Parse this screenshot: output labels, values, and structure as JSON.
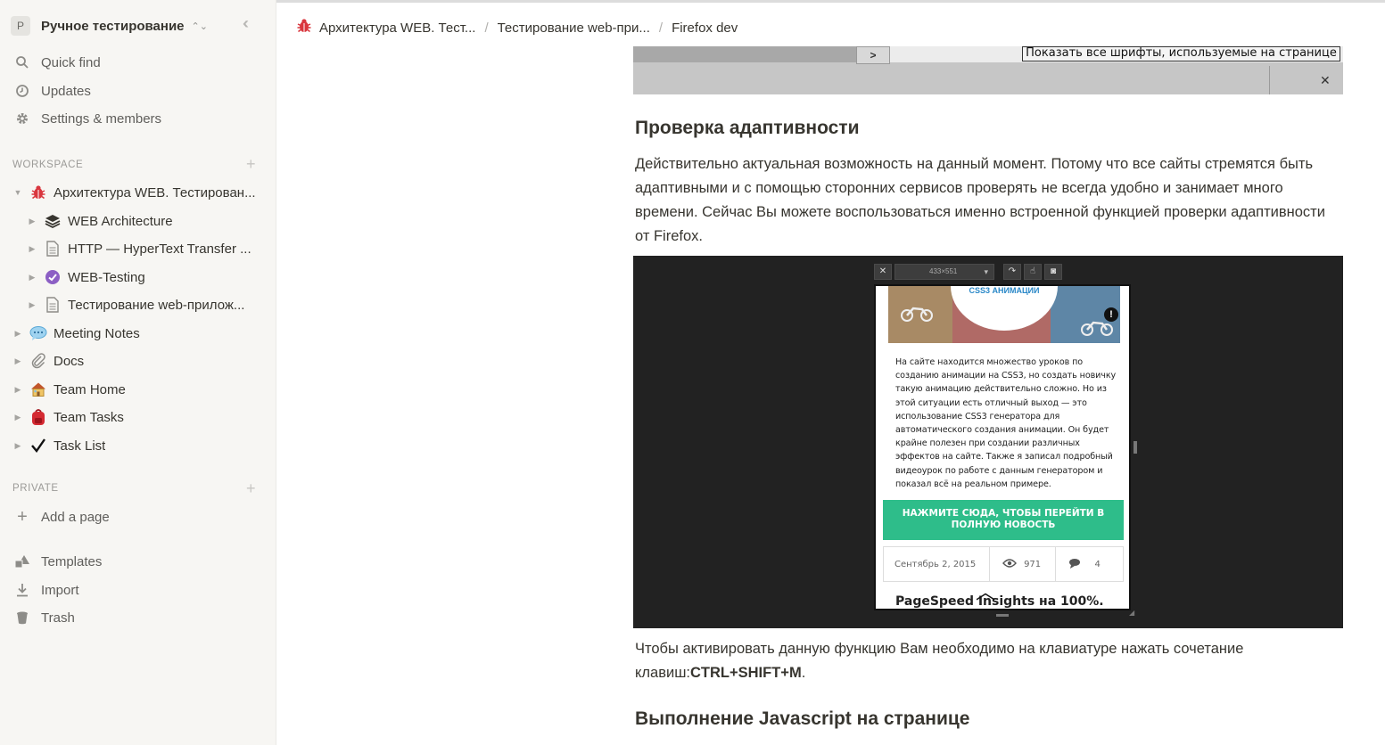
{
  "workspace": {
    "initial": "P",
    "name": "Ручное тестирование"
  },
  "sidebar": {
    "nav": [
      {
        "label": "Quick find",
        "icon": "search-icon"
      },
      {
        "label": "Updates",
        "icon": "clock-icon"
      },
      {
        "label": "Settings & members",
        "icon": "gear-icon"
      }
    ],
    "workspace_label": "WORKSPACE",
    "workspace_root": {
      "label": "Архитектура WEB. Тестирован...",
      "icon": "bug-icon"
    },
    "workspace_children": [
      {
        "label": "WEB Architecture",
        "icon": "layers-icon"
      },
      {
        "label": "HTTP — HyperText Transfer ...",
        "icon": "page-icon"
      },
      {
        "label": "WEB-Testing",
        "icon": "check-circle-icon"
      },
      {
        "label": "Тестирование web-прилож...",
        "icon": "page-icon"
      }
    ],
    "workspace_items": [
      {
        "label": "Meeting Notes",
        "icon": "speech-bubble-icon"
      },
      {
        "label": "Docs",
        "icon": "paperclip-icon"
      },
      {
        "label": "Team Home",
        "icon": "house-icon"
      },
      {
        "label": "Team Tasks",
        "icon": "backpack-icon"
      },
      {
        "label": "Task List",
        "icon": "checkmark-icon"
      }
    ],
    "private_label": "PRIVATE",
    "add_page": "Add a page",
    "footer": [
      {
        "label": "Templates",
        "icon": "shapes-icon"
      },
      {
        "label": "Import",
        "icon": "download-icon"
      },
      {
        "label": "Trash",
        "icon": "trash-icon"
      }
    ]
  },
  "breadcrumb": [
    "Архитектура WEB. Тест...",
    "Тестирование web-при...",
    "Firefox dev"
  ],
  "content": {
    "fonts_button": "Показать все шрифты, используемые на странице",
    "heading_adaptive": "Проверка адаптивности",
    "para_adaptive": "Действительно актуальная возможность на данный момент. Потому что все сайты стремятся быть адаптивными и с помощью сторонних сервисов проверять не всегда удобно и занимает много времени. Сейчас Вы можете воспользоваться именно встроенной функцией проверки адаптивности от Firefox.",
    "para_shortcut_prefix": "Чтобы активировать данную функцию Вам необходимо на клавиатуре нажать сочетание клавиш:",
    "para_shortcut_keys": "CTRL+SHIFT+M",
    "para_shortcut_suffix": ".",
    "heading_js": "Выполнение Javascript на странице"
  },
  "responsive_shot": {
    "size_label": "433×551",
    "hero_title": "CSS3 АНИМАЦИИ",
    "article": "На сайте находится множество уроков по созданию анимации на CSS3, но создать новичку такую анимацию действительно сложно. Но из этой ситуации есть отличный выход — это использование CSS3 генератора для автоматического создания анимации. Он будет крайне полезен при создании различных эффектов на сайте. Также я записал подробный видеоурок по работе с данным генератором и показал всё на реальном примере.",
    "cta": "НАЖМИТЕ СЮДА, ЧТОБЫ ПЕРЕЙТИ В ПОЛНУЮ НОВОСТЬ",
    "date": "Сентябрь 2, 2015",
    "views": "971",
    "comments": "4",
    "post_title": "PageSpeed Insights на 100%."
  }
}
